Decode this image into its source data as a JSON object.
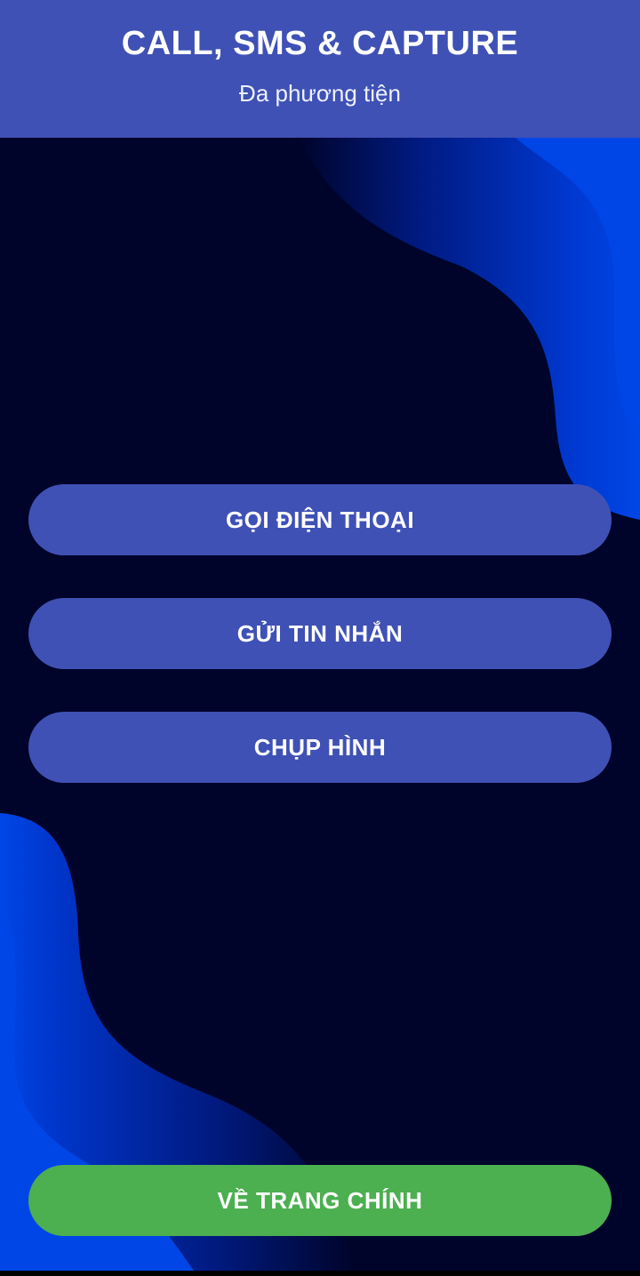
{
  "header": {
    "title": "CALL, SMS & CAPTURE",
    "subtitle": "Đa phương tiện"
  },
  "actions": {
    "call_label": "GỌI ĐIỆN THOẠI",
    "sms_label": "GỬI TIN NHẮN",
    "capture_label": "CHỤP HÌNH",
    "home_label": "VỀ TRANG CHÍNH"
  },
  "colors": {
    "header_bg": "#3f51b5",
    "button_primary": "#3f51b5",
    "button_home": "#4caf50",
    "background": "#00042a",
    "wave_accent": "#0046e6"
  }
}
